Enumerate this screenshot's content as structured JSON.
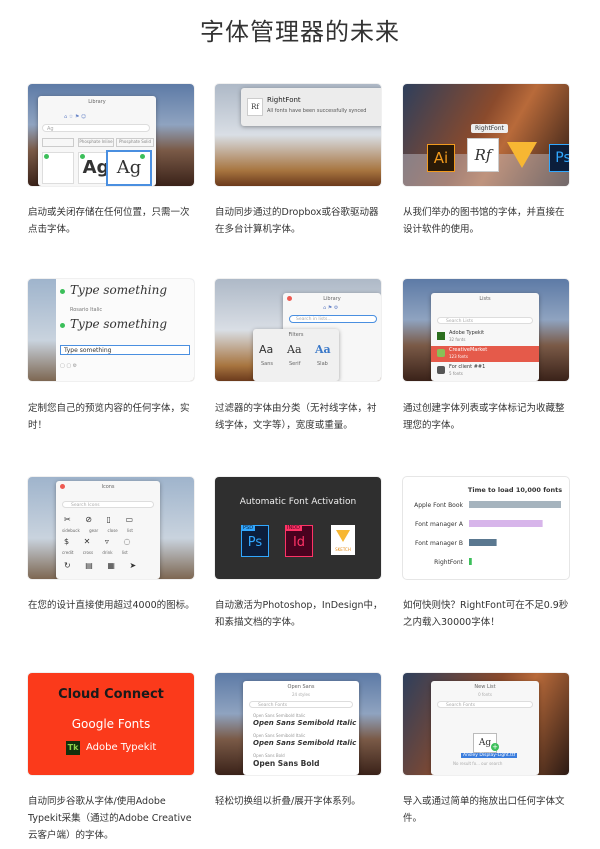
{
  "title": "字体管理器的未来",
  "cards": [
    {
      "caption": "启动或关闭存储在任何位置，只需一次点击字体。",
      "ui": {
        "win_title": "Library",
        "search": "Ag",
        "chips": [
          "",
          "Phosphate Inline",
          "Phosphate Solid"
        ],
        "glyph": "Ag"
      }
    },
    {
      "caption": "自动同步通过的Dropbox或谷歌驱动器在多台计算机字体。",
      "ui": {
        "app": "RightFont",
        "message": "All fonts have been successfully synced"
      }
    },
    {
      "caption": "从我们举办的图书馆的字体，并直接在设计软件的使用。",
      "ui": {
        "tooltip": "RightFont",
        "ai": "Ai",
        "rf": "Rf",
        "ps": "Ps"
      }
    },
    {
      "caption": "定制您自己的预览内容的任何字体，实时！",
      "ui": {
        "sample1": "Type something",
        "font2": "Rosario Italic",
        "sample2": "Type something",
        "input": "Type something"
      }
    },
    {
      "caption": "过滤器的字体由分类（无衬线字体，衬线字体，文字等），宽度或重量。",
      "ui": {
        "win_title": "Library",
        "search": "Search in lists...",
        "panel": "Filters",
        "samples": [
          "Aa",
          "Aa",
          "Aa"
        ],
        "labels": [
          "Sans",
          "Serif",
          "Slab"
        ]
      }
    },
    {
      "caption": "通过创建字体列表或字体标记为收藏整理您的字体。",
      "ui": {
        "win_title": "Lists",
        "search": "Search Lists",
        "items": [
          {
            "name": "Adobe Typekit",
            "sub": "32 fonts"
          },
          {
            "name": "CreativeMarket",
            "sub": "123 fonts"
          },
          {
            "name": "For client ##1",
            "sub": "5 fonts"
          }
        ]
      }
    },
    {
      "caption": "在您的设计直接使用超过4000的图标。",
      "ui": {
        "win_title": "Icons",
        "search": "Search Icons",
        "labels": [
          "sidebuck",
          "gear",
          "close",
          "list",
          "credit",
          "cross",
          "drink",
          "list"
        ]
      }
    },
    {
      "caption": "自动激活为Photoshop，InDesign中，和素描文档的字体。",
      "ui": {
        "heading": "Automatic Font Activation",
        "psd_tag": "PSD",
        "ps": "Ps",
        "indd_tag": "INDD",
        "id": "Id",
        "sketch": "SKETCH"
      }
    },
    {
      "caption": "如何快则快？RightFont可在不足0.9秒之内载入30000字体！",
      "ui": {
        "chart_title": "Time to load 10,000 fonts"
      },
      "chart_data": {
        "type": "bar",
        "title": "Time to load 10,000 fonts",
        "categories": [
          "Apple Font Book",
          "Font manager A",
          "Font manager B",
          "RightFont"
        ],
        "values": [
          100,
          80,
          30,
          3
        ],
        "colors": [
          "#a6b4be",
          "#d7b5ea",
          "#5a7890",
          "#3cbf5a"
        ],
        "xlim": [
          0,
          100
        ]
      }
    },
    {
      "caption": "自动同步谷歌从字体/使用Adobe Typekit采集（通过的Adobe Creative云客户端）的字体。",
      "ui": {
        "line1": "Cloud Connect",
        "line2": "Google Fonts",
        "tk": "Tk",
        "line3": "Adobe Typekit"
      }
    },
    {
      "caption": "轻松切换组以折叠/展开字体系列。",
      "ui": {
        "win_title": "Open Sans",
        "subtitle": "24 styles",
        "search": "Search Fonts",
        "rows": [
          {
            "label": "Open Sans Semibold Italic",
            "sample": "Open Sans Semibold Italic"
          },
          {
            "label": "Open Sans Semibold Italic",
            "sample": "Open Sans Semibold Italic"
          },
          {
            "label": "Open Sans Bold",
            "sample": "Open Sans Bold"
          }
        ]
      }
    },
    {
      "caption": "导入或通过简单的拖放出口任何字体文件。",
      "ui": {
        "win_title": "New List",
        "subtitle": "0 fonts",
        "search": "Search Fonts",
        "glyph": "Ag",
        "drag_label": "Ansley Display-Light.ttf",
        "no_result": "No result fo... our search"
      }
    }
  ]
}
